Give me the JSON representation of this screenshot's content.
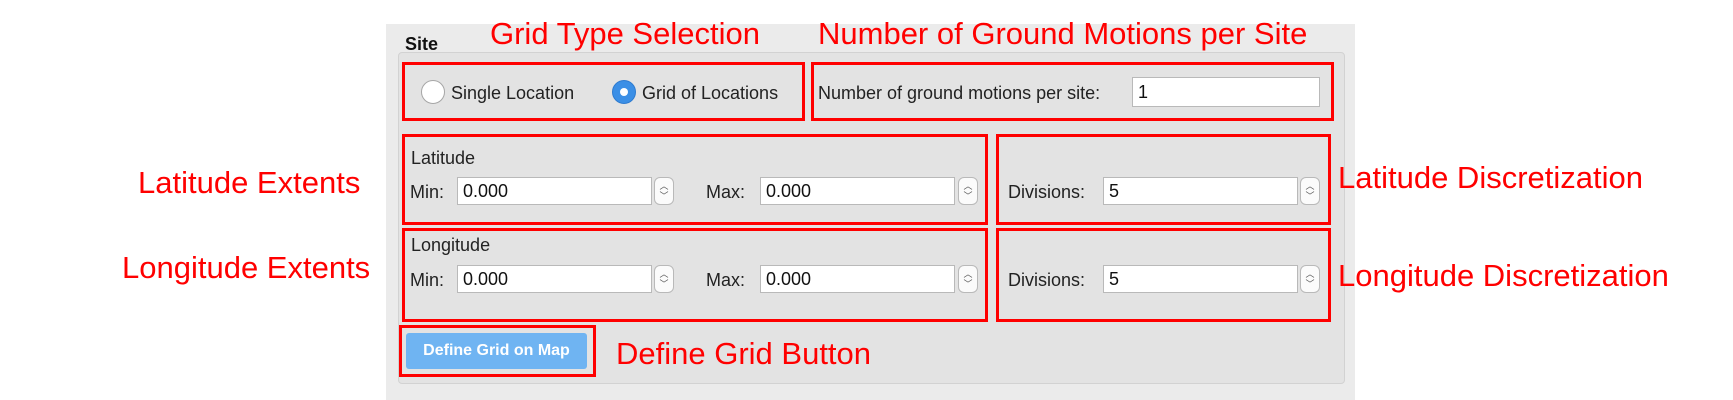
{
  "panel": {
    "title": "Site"
  },
  "annotations": {
    "grid_type": "Grid Type Selection",
    "motions": "Number of Ground Motions per Site",
    "lat_extents": "Latitude Extents",
    "lat_disc": "Latitude Discretization",
    "lon_extents": "Longitude Extents",
    "lon_disc": "Longitude Discretization",
    "define_btn": "Define Grid Button",
    "color": "#ff0000"
  },
  "grid_type": {
    "single_label": "Single Location",
    "grid_label": "Grid of Locations",
    "selected": "Grid of Locations"
  },
  "motions": {
    "label": "Number of ground motions per site:",
    "value": "1"
  },
  "latitude": {
    "title": "Latitude",
    "min_label": "Min:",
    "min_value": "0.000",
    "max_label": "Max:",
    "max_value": "0.000",
    "div_label": "Divisions:",
    "div_value": "5"
  },
  "longitude": {
    "title": "Longitude",
    "min_label": "Min:",
    "min_value": "0.000",
    "max_label": "Max:",
    "max_value": "0.000",
    "div_label": "Divisions:",
    "div_value": "5"
  },
  "define_button": {
    "label": "Define Grid on Map",
    "color": "#6fb4f2"
  },
  "icons": {
    "radio_selected": "radio-selected-icon",
    "spinner": "spinner-arrows-icon"
  }
}
